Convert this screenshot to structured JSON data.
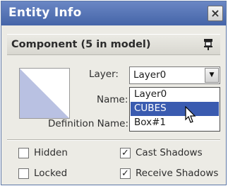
{
  "window": {
    "title": "Entity Info",
    "close_symbol": "×"
  },
  "section": {
    "title": "Component (5 in model)"
  },
  "fields": {
    "layer_label": "Layer:",
    "layer_value": "Layer0",
    "name_label": "Name:",
    "definition_label": "Definition Name:"
  },
  "dropdown": {
    "options": [
      "Layer0",
      "CUBES",
      "Box#1"
    ],
    "highlighted": "CUBES"
  },
  "checkboxes": {
    "hidden": {
      "label": "Hidden",
      "checked": false
    },
    "locked": {
      "label": "Locked",
      "checked": false
    },
    "cast_shadows": {
      "label": "Cast Shadows",
      "checked": true
    },
    "receive_shadows": {
      "label": "Receive Shadows",
      "checked": true
    }
  },
  "colors": {
    "titlebar": "#4a6ab0",
    "preview_fill": "#b9c1e2",
    "selection": "#3a5bb0"
  }
}
